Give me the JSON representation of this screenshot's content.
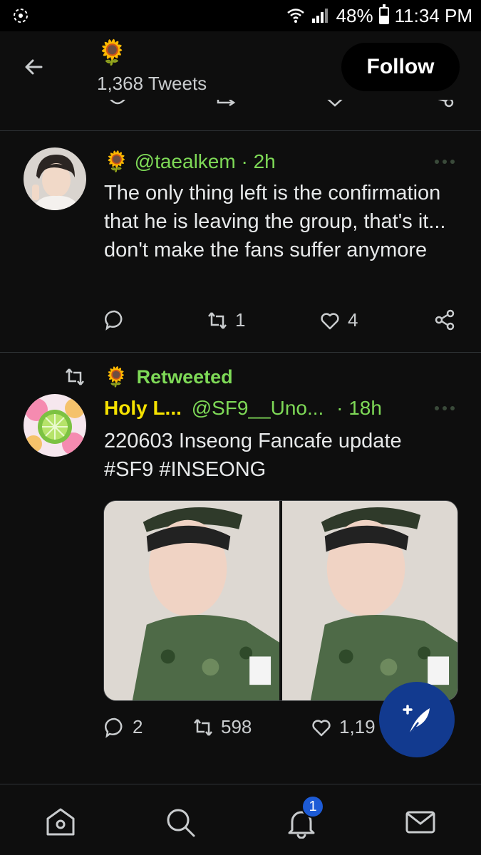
{
  "status_bar": {
    "battery": "48%",
    "time": "11:34 PM",
    "battery_level": 0.48
  },
  "header": {
    "title_emoji": "🌻",
    "tweet_count": "1,368 Tweets",
    "follow_label": "Follow"
  },
  "tweets": [
    {
      "name_emoji": "🌻",
      "handle": "@taealkem",
      "time": "· 2h",
      "text": "The only thing left is the confirmation that he is leaving the group, that's it... don't make the fans suffer anymore",
      "replies": "",
      "retweets": "1",
      "likes": "4"
    },
    {
      "retweet_banner": {
        "emoji": "🌻",
        "label": "Retweeted"
      },
      "name": "Holy L...",
      "handle": "@SF9__Uno...",
      "time": "· 18h",
      "text": "220603 Inseong Fancafe update",
      "hashtags": "#SF9 #INSEONG",
      "replies": "2",
      "retweets": "598",
      "likes": "1,19"
    }
  ],
  "nav": {
    "notifications_badge": "1"
  },
  "colors": {
    "accent_green": "#7ed957",
    "name_yellow": "#f5e100",
    "fab": "#123a8f",
    "badge": "#1d5bd6"
  }
}
